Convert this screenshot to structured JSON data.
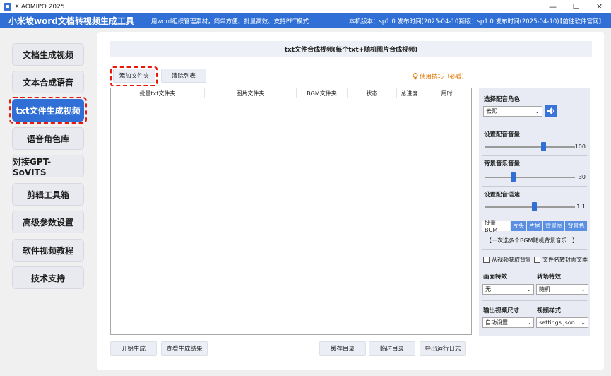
{
  "window": {
    "app_name": "XIAOMIPO 2025"
  },
  "header": {
    "title": "小米坡word文档转视频生成工具",
    "tagline": "用word组织管理素材，简单方便、批量高效、支持PPT模式",
    "version": "本机版本：sp1.0  发布时间(2025-04-10)",
    "new_version": "新版：sp1.0  发布时间(2025-04-10)",
    "site_link": "【前往软件官网】"
  },
  "sidebar": {
    "items": [
      {
        "label": "文档生成视频"
      },
      {
        "label": "文本合成语音"
      },
      {
        "label": "txt文件生成视频"
      },
      {
        "label": "语音角色库"
      },
      {
        "label": "对接GPT-SoVITS"
      },
      {
        "label": "剪辑工具箱"
      },
      {
        "label": "高级参数设置"
      },
      {
        "label": "软件视频教程"
      },
      {
        "label": "技术支持"
      }
    ],
    "active_index": 2
  },
  "main": {
    "title": "txt文件合成视频(每个txt+随机图片合成视频)",
    "add_folder": "添加文件夹",
    "clear_list": "清除列表",
    "tips": "使用技巧（必看）",
    "table": {
      "columns": [
        "批量txt文件夹",
        "图片文件夹",
        "BGM文件夹",
        "状态",
        "总进度",
        "用时"
      ],
      "rows": []
    },
    "bottom": {
      "start": "开始生成",
      "view_results": "查看生成结果",
      "cache_dir": "缓存目录",
      "temp_dir": "临时目录",
      "export_log": "导出运行日志"
    }
  },
  "settings": {
    "voice_role_label": "选择配音角色",
    "voice_role_value": "云熙",
    "voice_volume_label": "设置配音音量",
    "voice_volume_value": "100",
    "bgm_volume_label": "背景音乐音量",
    "bgm_volume_value": "30",
    "voice_speed_label": "设置配音语速",
    "voice_speed_value": "1.1",
    "bgm_tabs": [
      "批量BGM",
      "片头",
      "片尾",
      "背景图",
      "背景色"
    ],
    "bgm_hint": "【一次选多个BGM随机背景音乐...】",
    "check_bg_from_video": "从视频获取背景",
    "check_filename_cover": "文件名转封面文本",
    "effect_label": "画面特效",
    "effect_value": "无",
    "transition_label": "转场特效",
    "transition_value": "随机",
    "size_label": "输出视频尺寸",
    "size_value": "自动设置",
    "style_label": "视频样式",
    "style_value": "settings.json"
  },
  "colors": {
    "accent": "#2f6fd6",
    "highlight": "#e8180c",
    "tips": "#e37500"
  }
}
